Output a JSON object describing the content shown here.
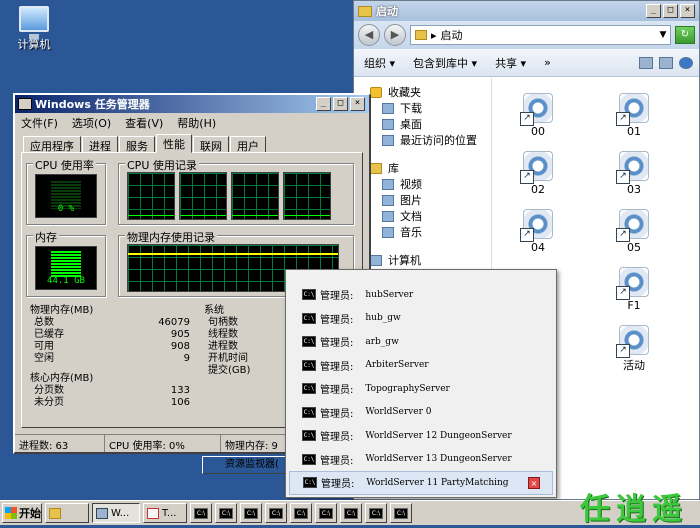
{
  "desktop": {
    "computer_label": "计算机"
  },
  "explorer": {
    "title": "启动",
    "address": "启动",
    "toolbar": {
      "organize": "组织 ▾",
      "include_library": "包含到库中 ▾",
      "share": "共享 ▾",
      "more": "»"
    },
    "nav": {
      "favorites": "收藏夹",
      "downloads": "下载",
      "desktop": "桌面",
      "recent": "最近访问的位置",
      "libraries": "库",
      "videos": "视频",
      "pictures": "图片",
      "documents": "文档",
      "music": "音乐",
      "computer": "计算机"
    },
    "files": [
      "00",
      "01",
      "02",
      "03",
      "04",
      "05",
      "F1",
      "活动"
    ]
  },
  "taskmgr": {
    "title": "Windows 任务管理器",
    "menu": {
      "file": "文件(F)",
      "options": "选项(O)",
      "view": "查看(V)",
      "help": "帮助(H)"
    },
    "tabs": [
      "应用程序",
      "进程",
      "服务",
      "性能",
      "联网",
      "用户"
    ],
    "active_tab": "性能",
    "cpu_usage_label": "CPU 使用率",
    "cpu_usage_value": "0 %",
    "cpu_history_label": "CPU 使用记录",
    "memory_label": "内存",
    "memory_value": "44.1 GB",
    "memory_history_label": "物理内存使用记录",
    "physical_memory": {
      "header": "物理内存(MB)",
      "rows": [
        {
          "label": "总数",
          "value": "46079"
        },
        {
          "label": "已缓存",
          "value": "905"
        },
        {
          "label": "可用",
          "value": "908"
        },
        {
          "label": "空闲",
          "value": "9"
        }
      ]
    },
    "kernel_memory": {
      "header": "核心内存(MB)",
      "rows": [
        {
          "label": "分页数",
          "value": "133"
        },
        {
          "label": "未分页",
          "value": "106"
        }
      ]
    },
    "system": {
      "header": "系统",
      "rows": [
        "句柄数",
        "线程数",
        "进程数",
        "开机时间",
        "提交(GB)"
      ]
    },
    "resource_monitor_button": "资源监视器(",
    "status": {
      "processes": "进程数: 63",
      "cpu": "CPU 使用率: 0%",
      "memory": "物理内存: 9"
    }
  },
  "popup": {
    "items": [
      {
        "who": "管理员:",
        "name": "hubServer"
      },
      {
        "who": "管理员:",
        "name": "hub_gw"
      },
      {
        "who": "管理员:",
        "name": "arb_gw"
      },
      {
        "who": "管理员:",
        "name": "ArbiterServer"
      },
      {
        "who": "管理员:",
        "name": "TopographyServer"
      },
      {
        "who": "管理员:",
        "name": "WorldServer 0"
      },
      {
        "who": "管理员:",
        "name": "WorldServer 12 DungeonServer"
      },
      {
        "who": "管理员:",
        "name": "WorldServer 13 DungeonServer"
      },
      {
        "who": "管理员:",
        "name": "WorldServer 11 PartyMatching"
      }
    ]
  },
  "taskbar": {
    "start": "开始",
    "buttons": [
      "W...",
      "T..."
    ],
    "watermark": "任逍遥"
  }
}
